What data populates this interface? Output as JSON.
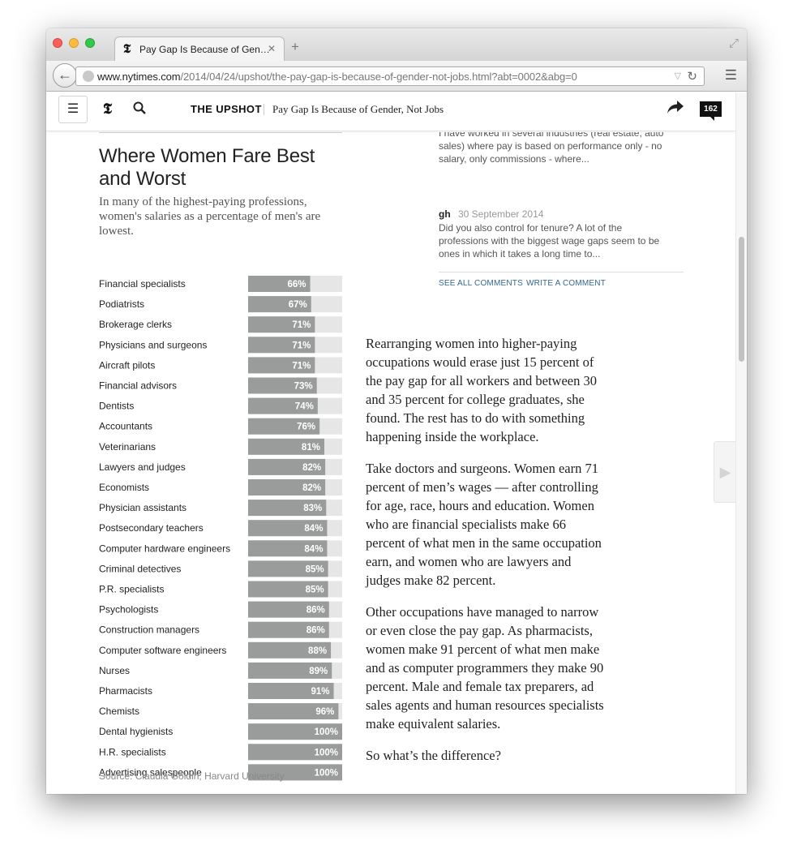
{
  "browser": {
    "tab_title": "Pay Gap Is Because of Gen…",
    "tab_close": "✕",
    "new_tab": "+",
    "url_host": "www.nytimes.com",
    "url_path": "/2014/04/24/upshot/the-pay-gap-is-because-of-gender-not-jobs.html?abt=0002&abg=0"
  },
  "header": {
    "section": "THE UPSHOT",
    "headline": "Pay Gap Is Because of Gender, Not Jobs",
    "comment_count": "162"
  },
  "chart": {
    "title": "Where Women Fare Best and Worst",
    "subtitle": "In many of the highest-paying professions, women's salaries as a percentage of men's are lowest.",
    "source": "Source: Claudia Goldin, Harvard University"
  },
  "chart_data": {
    "type": "bar",
    "orientation": "horizontal",
    "title": "Where Women Fare Best and Worst",
    "unit": "%",
    "xlim": [
      0,
      100
    ],
    "categories": [
      "Financial specialists",
      "Podiatrists",
      "Brokerage clerks",
      "Physicians and surgeons",
      "Aircraft pilots",
      "Financial advisors",
      "Dentists",
      "Accountants",
      "Veterinarians",
      "Lawyers and judges",
      "Economists",
      "Physician assistants",
      "Postsecondary teachers",
      "Computer hardware engineers",
      "Criminal detectives",
      "P.R. specialists",
      "Psychologists",
      "Construction managers",
      "Computer software engineers",
      "Nurses",
      "Pharmacists",
      "Chemists",
      "Dental hygienists",
      "H.R. specialists",
      "Advertising salespeople"
    ],
    "values": [
      66,
      67,
      71,
      71,
      71,
      73,
      74,
      76,
      81,
      82,
      82,
      83,
      84,
      84,
      85,
      85,
      86,
      86,
      88,
      89,
      91,
      96,
      100,
      100,
      100
    ],
    "bar_color": "#9a9c9c",
    "track_color": "#e6e6e6"
  },
  "comments": {
    "snippet": "I have worked in several industries (real estate, auto sales) where pay is based on performance only - no salary, only commissions - where...",
    "author": "gh",
    "date": "30 September 2014",
    "body": "Did you also control for tenure? A lot of the professions with the biggest wage gaps seem to be ones in which it takes a long time to...",
    "see_all": "SEE ALL COMMENTS",
    "write": "WRITE A COMMENT"
  },
  "article": {
    "p1": "Rearranging women into higher-paying occupations would erase just 15 percent of the pay gap for all workers and between 30 and 35 percent for college graduates, she found. The rest has to do with something happening inside the workplace.",
    "p2": "Take doctors and surgeons. Women earn 71 percent of men’s wages — after controlling for age, race, hours and education. Women who are financial specialists make 66 percent of what men in the same occupation earn, and women who are lawyers and judges make 82 percent.",
    "p3": "Other occupations have managed to narrow or even close the pay gap. As pharmacists, women make 91 percent of what men make and as computer programmers they make 90 percent. Male and female tax preparers, ad sales agents and human resources specialists make equivalent salaries.",
    "p4": "So what’s the difference?"
  },
  "icons": {
    "back": "arrow-left-icon",
    "reload": "reload-icon",
    "menu": "menu-icon",
    "search": "search-icon",
    "share": "share-icon",
    "next": "chevron-right-icon"
  }
}
